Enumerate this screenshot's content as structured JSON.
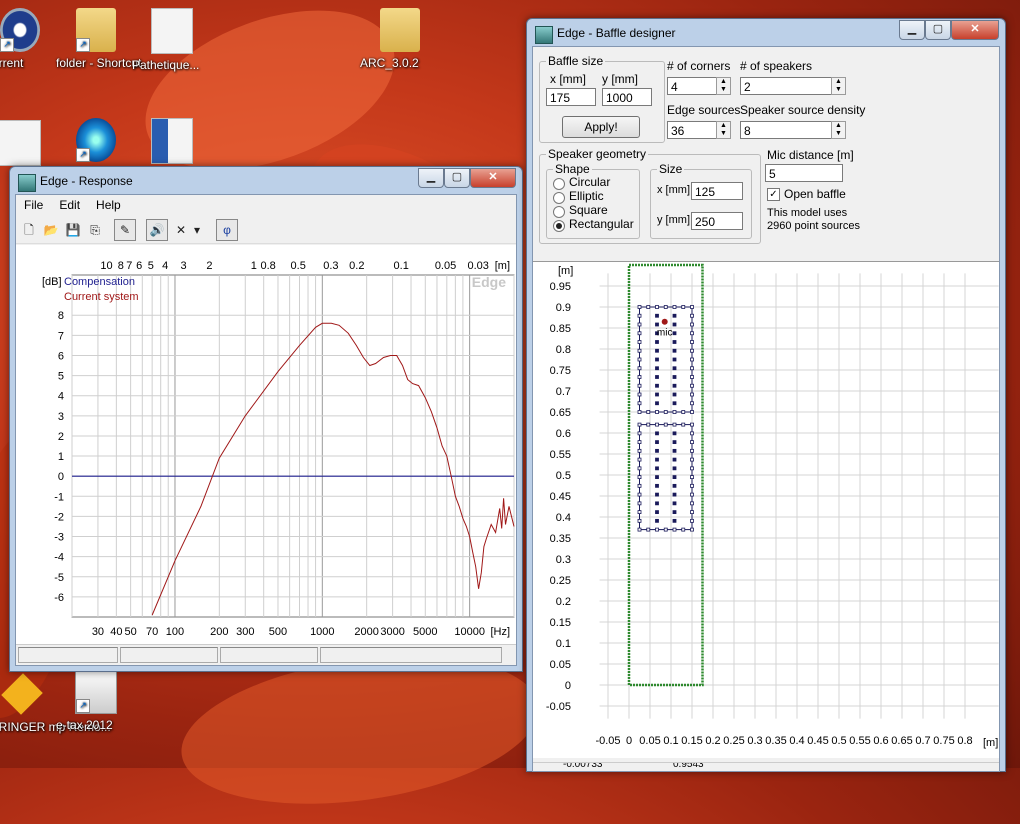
{
  "desktop": {
    "icons": [
      {
        "label": "itTorrent"
      },
      {
        "label": "folder - Shortcut"
      },
      {
        "label": "Pathetique..."
      },
      {
        "label": "ARC_3.0.2"
      },
      {
        "label": "EHRINGER mp Remo..."
      },
      {
        "label": "e-tax 2012"
      }
    ]
  },
  "response_window": {
    "title": "Edge - Response",
    "menu": [
      "File",
      "Edit",
      "Help"
    ],
    "toolbar_icons": [
      "new-icon",
      "open-icon",
      "save-icon",
      "copy-icon",
      "pencil-icon",
      "speaker-icon",
      "delete-icon",
      "dropdown-icon",
      "phase-icon"
    ],
    "phase_symbol": "φ",
    "delete_symbol": "✕",
    "dropdown_symbol": "▾",
    "legend": [
      "Compensation",
      "Current system"
    ],
    "watermark": "Edge",
    "status_cells": [
      "",
      "",
      "",
      ""
    ]
  },
  "chart_data": {
    "type": "line",
    "ylabel": "[dB]",
    "xlabel": "[Hz]",
    "top_axis_label": "[m]",
    "xscale": "log",
    "xlim": [
      20,
      20000
    ],
    "ylim": [
      -7,
      10
    ],
    "yticks": [
      8,
      7,
      6,
      5,
      4,
      3,
      2,
      1,
      0,
      -1,
      -2,
      -3,
      -4,
      -5,
      -6
    ],
    "xtick_labels": [
      {
        "f": 30,
        "t": "30"
      },
      {
        "f": 40,
        "t": "40"
      },
      {
        "f": 50,
        "t": "50"
      },
      {
        "f": 70,
        "t": "70"
      },
      {
        "f": 100,
        "t": "100"
      },
      {
        "f": 200,
        "t": "200"
      },
      {
        "f": 300,
        "t": "300"
      },
      {
        "f": 500,
        "t": "500"
      },
      {
        "f": 1000,
        "t": "1000"
      },
      {
        "f": 2000,
        "t": "2000"
      },
      {
        "f": 3000,
        "t": "3000"
      },
      {
        "f": 5000,
        "t": "5000"
      },
      {
        "f": 10000,
        "t": "10000"
      }
    ],
    "top_tick_labels": [
      {
        "m": 10,
        "t": "10"
      },
      {
        "m": 8,
        "t": "8"
      },
      {
        "m": 7,
        "t": "7"
      },
      {
        "m": 6,
        "t": "6"
      },
      {
        "m": 5,
        "t": "5"
      },
      {
        "m": 4,
        "t": "4"
      },
      {
        "m": 3,
        "t": "3"
      },
      {
        "m": 2,
        "t": "2"
      },
      {
        "m": 1,
        "t": "1"
      },
      {
        "m": 0.8,
        "t": "0.8"
      },
      {
        "m": 0.5,
        "t": "0.5"
      },
      {
        "m": 0.3,
        "t": "0.3"
      },
      {
        "m": 0.2,
        "t": "0.2"
      },
      {
        "m": 0.1,
        "t": "0.1"
      },
      {
        "m": 0.05,
        "t": "0.05"
      },
      {
        "m": 0.03,
        "t": "0.03"
      }
    ],
    "series": [
      {
        "name": "Compensation",
        "color": "#1f1f8f",
        "points": [
          [
            20,
            0
          ],
          [
            20000,
            0
          ]
        ]
      },
      {
        "name": "Current system",
        "color": "#a01818",
        "points": [
          [
            70,
            -6.9
          ],
          [
            100,
            -4.2
          ],
          [
            150,
            -1.5
          ],
          [
            200,
            0.9
          ],
          [
            300,
            3.0
          ],
          [
            500,
            5.2
          ],
          [
            700,
            6.5
          ],
          [
            900,
            7.4
          ],
          [
            1000,
            7.6
          ],
          [
            1150,
            7.6
          ],
          [
            1300,
            7.5
          ],
          [
            1500,
            7.1
          ],
          [
            1700,
            6.5
          ],
          [
            1900,
            5.9
          ],
          [
            2100,
            5.5
          ],
          [
            2300,
            5.6
          ],
          [
            2600,
            5.9
          ],
          [
            2900,
            6.0
          ],
          [
            3200,
            6.0
          ],
          [
            3500,
            5.5
          ],
          [
            3800,
            4.8
          ],
          [
            4100,
            4.6
          ],
          [
            4500,
            4.5
          ],
          [
            5000,
            3.9
          ],
          [
            5500,
            3.2
          ],
          [
            6000,
            2.4
          ],
          [
            6500,
            1.5
          ],
          [
            7000,
            1.0
          ],
          [
            7500,
            0.0
          ],
          [
            8000,
            -1.0
          ],
          [
            8500,
            -1.5
          ],
          [
            9000,
            -2.1
          ],
          [
            9500,
            -2.5
          ],
          [
            10000,
            -3.0
          ],
          [
            10500,
            -3.8
          ],
          [
            11000,
            -4.5
          ],
          [
            11500,
            -5.6
          ],
          [
            12000,
            -4.8
          ],
          [
            12500,
            -3.5
          ],
          [
            13000,
            -3.1
          ],
          [
            14000,
            -2.4
          ],
          [
            15000,
            -2.8
          ],
          [
            16000,
            -1.6
          ],
          [
            16500,
            -2.6
          ],
          [
            17000,
            -1.1
          ],
          [
            17500,
            -2.4
          ],
          [
            18500,
            -1.5
          ],
          [
            20000,
            -2.5
          ]
        ]
      }
    ]
  },
  "baffle_window": {
    "title": "Edge - Baffle designer",
    "baffle_size": {
      "title": "Baffle size",
      "x_label": "x [mm]",
      "y_label": "y [mm]",
      "x_value": "175",
      "y_value": "1000",
      "apply_label": "Apply!"
    },
    "corners": {
      "label": "# of corners",
      "value": "4"
    },
    "speakers": {
      "label": "# of speakers",
      "value": "2"
    },
    "edge_sources": {
      "label": "Edge sources",
      "value": "36"
    },
    "speaker_density": {
      "label": "Speaker source density",
      "value": "8"
    },
    "speaker_geometry": {
      "title": "Speaker geometry",
      "shape_title": "Shape",
      "shapes": [
        "Circular",
        "Elliptic",
        "Square",
        "Rectangular"
      ],
      "selected_shape": "Rectangular",
      "size_title": "Size",
      "x_label": "x [mm]",
      "x_value": "125",
      "y_label": "y [mm]",
      "y_value": "250"
    },
    "mic_distance": {
      "label": "Mic distance [m]",
      "value": "5"
    },
    "open_baffle": {
      "label": "Open baffle",
      "checked": true
    },
    "model_info": [
      "This model uses",
      "2960 point sources"
    ],
    "plot": {
      "unit_label": "[m]",
      "mic_label": "mic",
      "y_ticks": [
        "0.95",
        "0.9",
        "0.85",
        "0.8",
        "0.75",
        "0.7",
        "0.65",
        "0.6",
        "0.55",
        "0.5",
        "0.45",
        "0.4",
        "0.35",
        "0.3",
        "0.25",
        "0.2",
        "0.15",
        "0.1",
        "0.05",
        "0",
        "-0.05"
      ],
      "x_ticks": [
        "-0.05",
        "0",
        "0.05",
        "0.1",
        "0.15",
        "0.2",
        "0.25",
        "0.3",
        "0.35",
        "0.4",
        "0.45",
        "0.5",
        "0.55",
        "0.6",
        "0.65",
        "0.7",
        "0.75",
        "0.8"
      ],
      "baffle_width_m": 0.175,
      "baffle_height_m": 1.0,
      "speakers_m": [
        {
          "cx": 0.0875,
          "cy": 0.775,
          "w": 0.125,
          "h": 0.25
        },
        {
          "cx": 0.0875,
          "cy": 0.495,
          "w": 0.125,
          "h": 0.25
        }
      ],
      "mic_m": {
        "x": 0.085,
        "y": 0.865
      }
    },
    "status_values": [
      "-0.00733",
      "0.9543"
    ]
  }
}
